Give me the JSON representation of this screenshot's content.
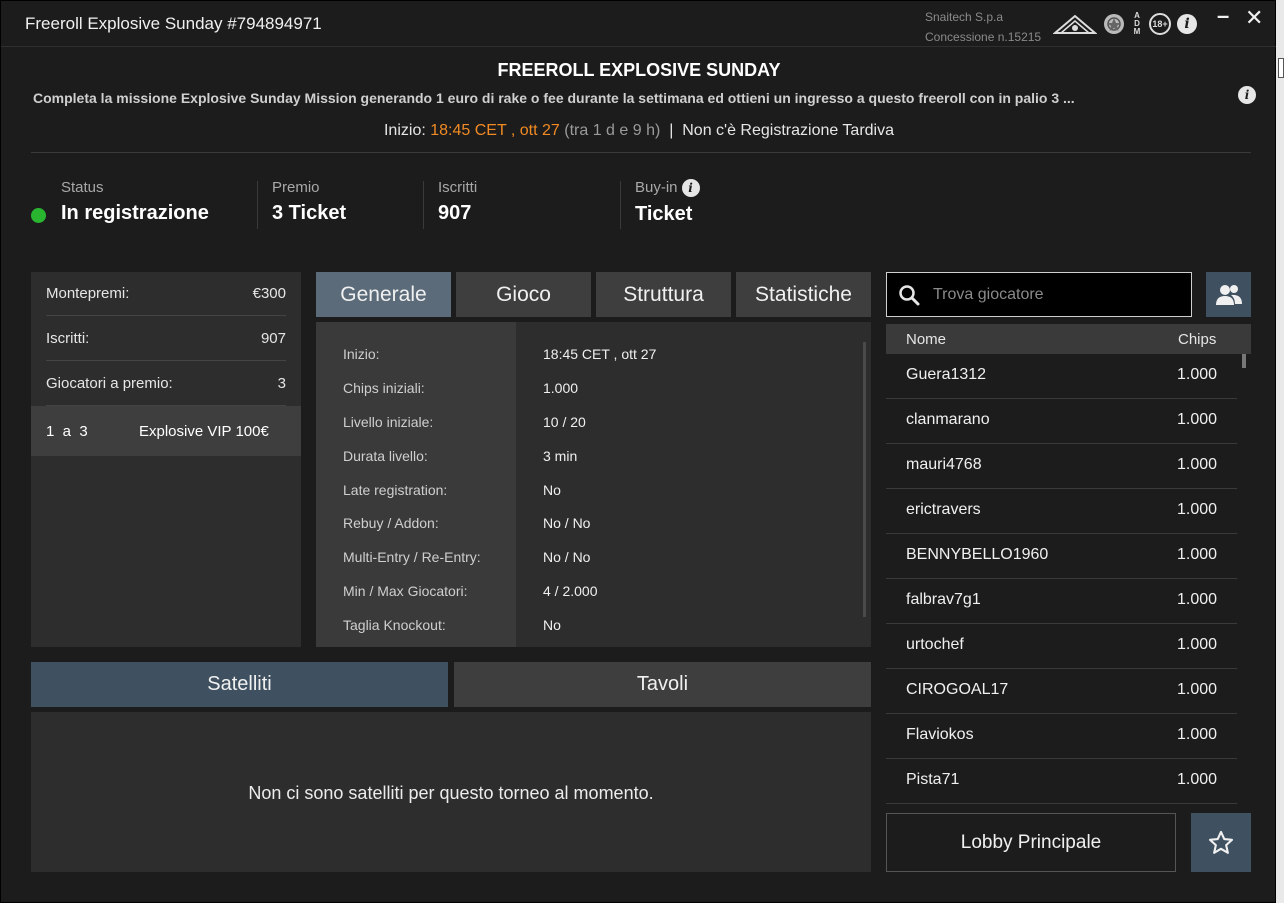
{
  "window": {
    "title": "Freeroll Explosive Sunday #794894971",
    "company_line1": "Snaitech S.p.a",
    "company_line2": "Concessione n.15215",
    "badge_18": "18+",
    "adm_letters": [
      "A",
      "D",
      "M"
    ]
  },
  "header": {
    "title": "FREEROLL EXPLOSIVE SUNDAY",
    "description": "Completa la missione Explosive Sunday Mission generando 1 euro di rake o fee durante la settimana ed ottieni un ingresso a questo freeroll con in palio 3 ...",
    "start_label": "Inizio:",
    "start_value": "18:45 CET , ott 27",
    "start_relative": "(tra 1 d e 9 h)",
    "separator": "|",
    "late_reg": "Non c'è Registrazione Tardiva"
  },
  "status": {
    "status_label": "Status",
    "status_value": "In registrazione",
    "prize_label": "Premio",
    "prize_value": "3 Ticket",
    "entrants_label": "Iscritti",
    "entrants_value": "907",
    "buyin_label": "Buy-in",
    "buyin_value": "Ticket",
    "status_color": "#2ab531"
  },
  "prize_panel": {
    "pool_label": "Montepremi:",
    "pool_value": "€300",
    "entrants_label": "Iscritti:",
    "entrants_value": "907",
    "paid_label": "Giocatori a premio:",
    "paid_value": "3",
    "prize_position": "1  a  3",
    "prize_name": "Explosive VIP 100€"
  },
  "tabs": {
    "general": "Generale",
    "game": "Gioco",
    "structure": "Struttura",
    "stats": "Statistiche"
  },
  "details": [
    {
      "k": "Inizio:",
      "v": "18:45 CET , ott 27"
    },
    {
      "k": "Chips iniziali:",
      "v": "1.000"
    },
    {
      "k": "Livello iniziale:",
      "v": "10 / 20"
    },
    {
      "k": "Durata livello:",
      "v": "3 min"
    },
    {
      "k": "Late registration:",
      "v": "No"
    },
    {
      "k": "Rebuy / Addon:",
      "v": "No / No"
    },
    {
      "k": "Multi-Entry / Re-Entry:",
      "v": "No / No"
    },
    {
      "k": "Min / Max Giocatori:",
      "v": "4 / 2.000"
    },
    {
      "k": "Taglia Knockout:",
      "v": "No"
    }
  ],
  "lower_tabs": {
    "satellites": "Satelliti",
    "tables": "Tavoli",
    "empty_message": "Non ci sono satelliti per questo torneo al momento."
  },
  "players": {
    "search_placeholder": "Trova giocatore",
    "col_name": "Nome",
    "col_chips": "Chips",
    "rows": [
      {
        "name": "Guera1312",
        "chips": "1.000"
      },
      {
        "name": "clanmarano",
        "chips": "1.000"
      },
      {
        "name": "mauri4768",
        "chips": "1.000"
      },
      {
        "name": "erictravers",
        "chips": "1.000"
      },
      {
        "name": "BENNYBELLO1960",
        "chips": "1.000"
      },
      {
        "name": "falbrav7g1",
        "chips": "1.000"
      },
      {
        "name": "urtochef",
        "chips": "1.000"
      },
      {
        "name": "CIROGOAL17",
        "chips": "1.000"
      },
      {
        "name": "Flaviokos",
        "chips": "1.000"
      },
      {
        "name": "Pista71",
        "chips": "1.000"
      }
    ]
  },
  "footer": {
    "lobby_button": "Lobby Principale"
  },
  "colors": {
    "accent_orange": "#f08a24",
    "tab_active": "#5b6b79",
    "button_blue": "#3f5060"
  }
}
